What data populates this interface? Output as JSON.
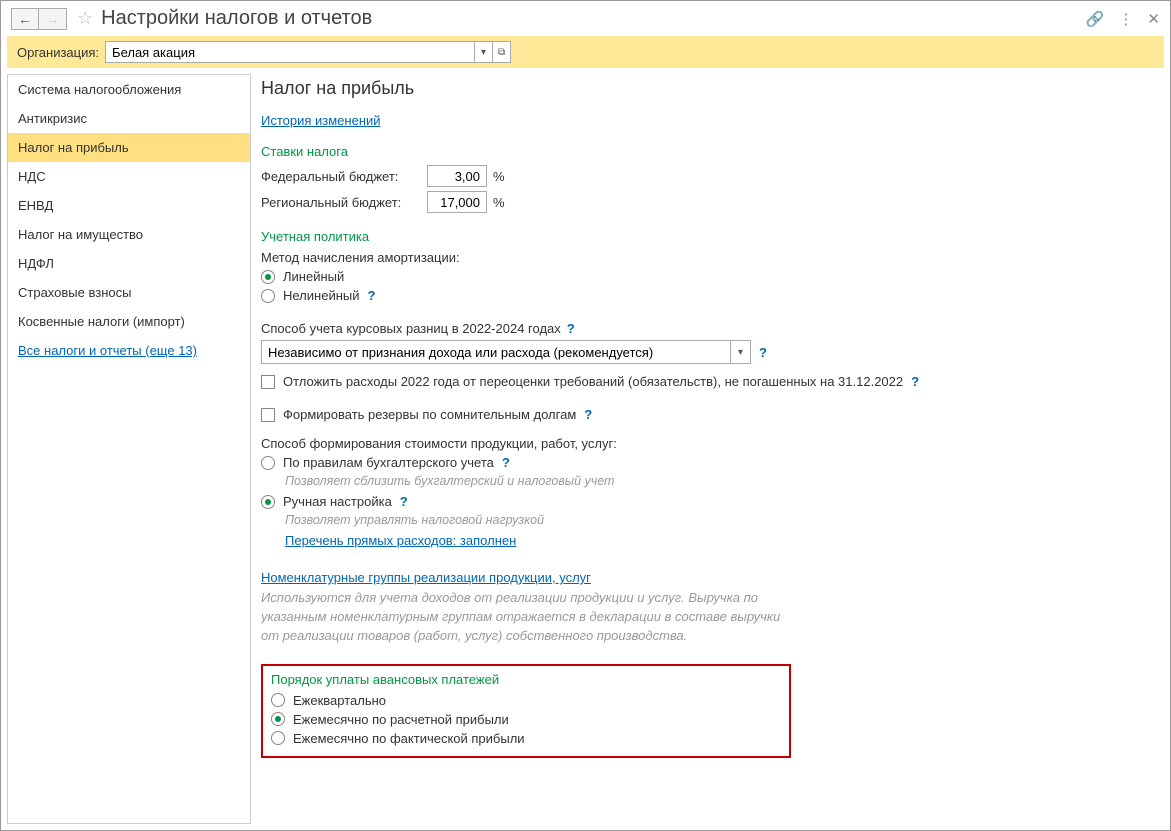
{
  "titlebar": {
    "title": "Настройки налогов и отчетов"
  },
  "org": {
    "label": "Организация:",
    "value": "Белая акация"
  },
  "sidebar": {
    "items": [
      "Система налогообложения",
      "Антикризис",
      "Налог на прибыль",
      "НДС",
      "ЕНВД",
      "Налог на имущество",
      "НДФЛ",
      "Страховые взносы",
      "Косвенные налоги (импорт)"
    ],
    "all_link": "Все налоги и отчеты (еще 13)"
  },
  "content": {
    "heading": "Налог на прибыль",
    "history_link": "История изменений",
    "rates": {
      "title": "Ставки налога",
      "federal_label": "Федеральный бюджет:",
      "federal_value": "3,00",
      "regional_label": "Региональный бюджет:",
      "regional_value": "17,000",
      "percent": "%"
    },
    "policy": {
      "title": "Учетная политика",
      "amort_label": "Метод начисления амортизации:",
      "amort_linear": "Линейный",
      "amort_nonlinear": "Нелинейный",
      "fx_label": "Способ учета курсовых разниц в 2022-2024 годах",
      "fx_value": "Независимо от признания дохода или расхода (рекомендуется)",
      "defer_label": "Отложить расходы 2022 года от переоценки требований (обязательств), не погашенных на 31.12.2022",
      "reserves_label": "Формировать резервы по сомнительным долгам",
      "cost_label": "Способ формирования стоимости продукции, работ, услуг:",
      "cost_opt1": "По правилам бухгалтерского учета",
      "cost_opt1_hint": "Позволяет сблизить бухгалтерский и налоговый учет",
      "cost_opt2": "Ручная настройка",
      "cost_opt2_hint": "Позволяет управлять налоговой нагрузкой",
      "direct_link": "Перечень прямых расходов: заполнен"
    },
    "nomen": {
      "link": "Номенклатурные группы реализации продукции, услуг",
      "desc": "Используются для учета доходов от реализации продукции и услуг. Выручка по указанным номенклатурным группам отражается в декларации в составе выручки от реализации товаров (работ, услуг) собственного производства."
    },
    "advance": {
      "title": "Порядок уплаты авансовых платежей",
      "opt1": "Ежеквартально",
      "opt2": "Ежемесячно по расчетной прибыли",
      "opt3": "Ежемесячно по фактической прибыли"
    }
  }
}
